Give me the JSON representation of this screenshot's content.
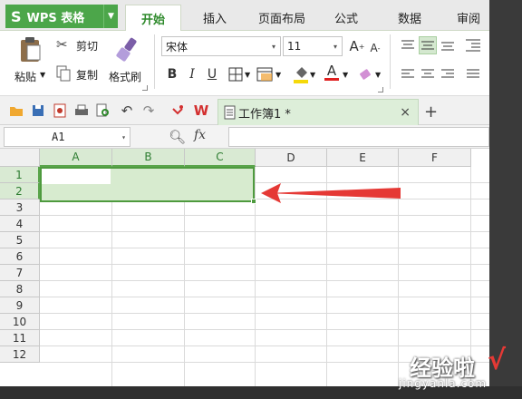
{
  "app": {
    "logo_text": "WPS 表格",
    "logo_glyph": "S",
    "menu_caret": "▼"
  },
  "tabs": [
    {
      "label": "开始",
      "active": true
    },
    {
      "label": "插入"
    },
    {
      "label": "页面布局"
    },
    {
      "label": "公式"
    },
    {
      "label": "数据"
    },
    {
      "label": "审阅"
    }
  ],
  "ribbon": {
    "paste_label": "粘贴",
    "cut_label": "剪切",
    "copy_label": "复制",
    "format_painter_label": "格式刷",
    "font_name": "宋体",
    "font_size": "11",
    "grow_font": "A",
    "shrink_font": "A",
    "bold": "B",
    "italic": "I",
    "underline": "U",
    "font_color_glyph": "A",
    "caret": "▾",
    "small_caret": "▼"
  },
  "quickbar": {
    "doc_tab_label": "工作簿1 *",
    "close_glyph": "×",
    "new_tab_glyph": "+"
  },
  "formula_bar": {
    "name_box": "A1",
    "fx_label": "fx",
    "formula_value": ""
  },
  "sheet": {
    "columns": [
      "A",
      "B",
      "C",
      "D",
      "E",
      "F"
    ],
    "rows": [
      "1",
      "2",
      "3",
      "4",
      "5",
      "6",
      "7",
      "8",
      "9",
      "10",
      "11",
      "12"
    ],
    "selected_range": "A1:C2",
    "selection_color": "#4e9a3e",
    "arrow_color": "#e53935"
  },
  "watermark": {
    "title": "经验啦",
    "url": "jingyanla.com",
    "check": "√"
  },
  "colors": {
    "brand_green": "#4ca64a",
    "active_tab_text": "#2f8a2c"
  }
}
